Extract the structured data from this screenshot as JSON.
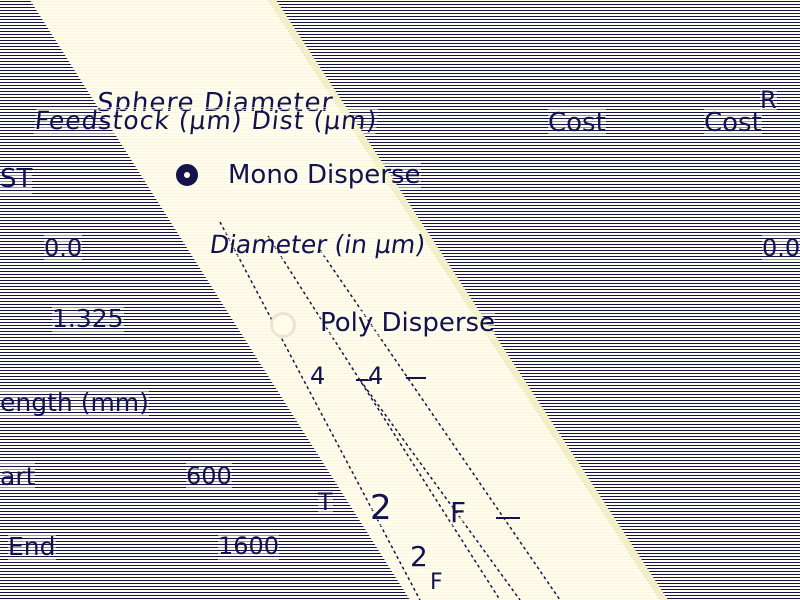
{
  "title": {
    "line1": "Sphere Diameter",
    "line2": "Feedstock (µm) Dist (µm)"
  },
  "columns": {
    "cost_a": "Cost",
    "cost_b": "Cost",
    "corner": "R"
  },
  "left_column": {
    "cut_label": "ST",
    "value_a": "0.0",
    "value_b": "1.325",
    "length_label": "ength (mm)",
    "start_label": "art",
    "start_value": "600",
    "end_label": "End",
    "end_value": "1600"
  },
  "right_value": "0.0",
  "options": {
    "mono_label": "Mono Disperse",
    "diameter_label": "Diameter (in µm)",
    "poly_label": "Poly Disperse",
    "poly_min": "4",
    "poly_max": "4",
    "mono_selected": true
  },
  "fragments": {
    "a": "T",
    "b": "2",
    "c": "F",
    "d": "2",
    "e": "F"
  },
  "colors": {
    "ink": "#14144a",
    "paper": "#fffde8"
  }
}
